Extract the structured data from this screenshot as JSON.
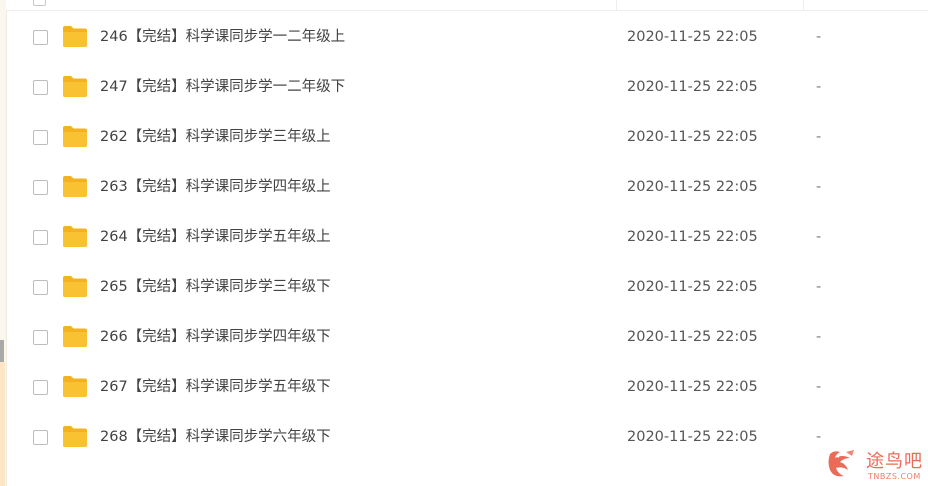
{
  "colors": {
    "folder": "#f9c232",
    "folder_tab": "#f4b120",
    "text": "#424242",
    "watermark": "#e8513c"
  },
  "icons": {
    "row_icon": "folder-icon",
    "watermark_logo": "tnbzs-logo-icon"
  },
  "files": [
    {
      "name": "246【完结】科学课同步学一二年级上",
      "modified": "2020-11-25 22:05",
      "size": "-"
    },
    {
      "name": "247【完结】科学课同步学一二年级下",
      "modified": "2020-11-25 22:05",
      "size": "-"
    },
    {
      "name": "262【完结】科学课同步学三年级上",
      "modified": "2020-11-25 22:05",
      "size": "-"
    },
    {
      "name": "263【完结】科学课同步学四年级上",
      "modified": "2020-11-25 22:05",
      "size": "-"
    },
    {
      "name": "264【完结】科学课同步学五年级上",
      "modified": "2020-11-25 22:05",
      "size": "-"
    },
    {
      "name": "265【完结】科学课同步学三年级下",
      "modified": "2020-11-25 22:05",
      "size": "-"
    },
    {
      "name": "266【完结】科学课同步学四年级下",
      "modified": "2020-11-25 22:05",
      "size": "-"
    },
    {
      "name": "267【完结】科学课同步学五年级下",
      "modified": "2020-11-25 22:05",
      "size": "-"
    },
    {
      "name": "268【完结】科学课同步学六年级下",
      "modified": "2020-11-25 22:05",
      "size": "-"
    }
  ],
  "watermark": {
    "text": "途鸟吧",
    "subtext": "TNBZS.COM"
  }
}
